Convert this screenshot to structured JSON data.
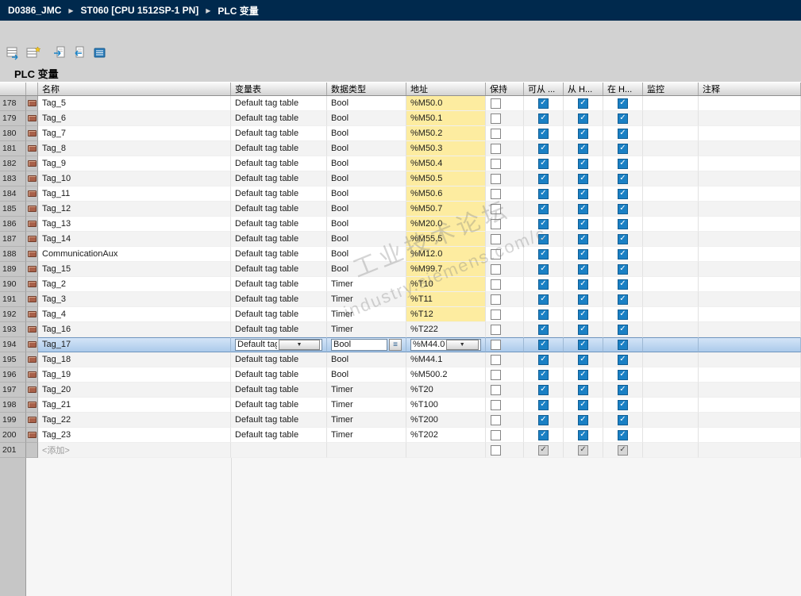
{
  "breadcrumb": {
    "items": [
      "D0386_JMC",
      "ST060 [CPU 1512SP-1 PN]",
      "PLC 变量"
    ]
  },
  "page_title": "PLC 变量",
  "toolbar": {
    "icons": [
      "insert-row-icon",
      "add-row-icon",
      "export-icon",
      "import-icon",
      "cross-reference-icon"
    ]
  },
  "watermark": {
    "line1": "工业技术论坛",
    "line2": "industry.siemens.com/c"
  },
  "colors": {
    "breadcrumb_bg": "#00294d",
    "selected_row": "#a9c9ea",
    "address_highlight": "#fdeca0",
    "checkbox_checked": "#1a80c4"
  },
  "table": {
    "headers": {
      "name": "名称",
      "tag_table": "变量表",
      "data_type": "数据类型",
      "address": "地址",
      "retain": "保持",
      "accessible": "可从 ...",
      "writable_hmi": "从 H...",
      "visible_hmi": "在 H...",
      "monitor": "监控",
      "comment": "注释"
    },
    "rows": [
      {
        "num": "178",
        "name": "Tag_5",
        "table": "Default tag table",
        "type": "Bool",
        "addr": "%M50.0",
        "yellow": true,
        "selected": false,
        "add": false
      },
      {
        "num": "179",
        "name": "Tag_6",
        "table": "Default tag table",
        "type": "Bool",
        "addr": "%M50.1",
        "yellow": true,
        "selected": false,
        "add": false
      },
      {
        "num": "180",
        "name": "Tag_7",
        "table": "Default tag table",
        "type": "Bool",
        "addr": "%M50.2",
        "yellow": true,
        "selected": false,
        "add": false
      },
      {
        "num": "181",
        "name": "Tag_8",
        "table": "Default tag table",
        "type": "Bool",
        "addr": "%M50.3",
        "yellow": true,
        "selected": false,
        "add": false
      },
      {
        "num": "182",
        "name": "Tag_9",
        "table": "Default tag table",
        "type": "Bool",
        "addr": "%M50.4",
        "yellow": true,
        "selected": false,
        "add": false
      },
      {
        "num": "183",
        "name": "Tag_10",
        "table": "Default tag table",
        "type": "Bool",
        "addr": "%M50.5",
        "yellow": true,
        "selected": false,
        "add": false
      },
      {
        "num": "184",
        "name": "Tag_11",
        "table": "Default tag table",
        "type": "Bool",
        "addr": "%M50.6",
        "yellow": true,
        "selected": false,
        "add": false
      },
      {
        "num": "185",
        "name": "Tag_12",
        "table": "Default tag table",
        "type": "Bool",
        "addr": "%M50.7",
        "yellow": true,
        "selected": false,
        "add": false
      },
      {
        "num": "186",
        "name": "Tag_13",
        "table": "Default tag table",
        "type": "Bool",
        "addr": "%M20.0",
        "yellow": true,
        "selected": false,
        "add": false
      },
      {
        "num": "187",
        "name": "Tag_14",
        "table": "Default tag table",
        "type": "Bool",
        "addr": "%M55.5",
        "yellow": true,
        "selected": false,
        "add": false
      },
      {
        "num": "188",
        "name": "CommunicationAux",
        "table": "Default tag table",
        "type": "Bool",
        "addr": "%M12.0",
        "yellow": true,
        "selected": false,
        "add": false
      },
      {
        "num": "189",
        "name": "Tag_15",
        "table": "Default tag table",
        "type": "Bool",
        "addr": "%M99.7",
        "yellow": true,
        "selected": false,
        "add": false
      },
      {
        "num": "190",
        "name": "Tag_2",
        "table": "Default tag table",
        "type": "Timer",
        "addr": "%T10",
        "yellow": true,
        "selected": false,
        "add": false
      },
      {
        "num": "191",
        "name": "Tag_3",
        "table": "Default tag table",
        "type": "Timer",
        "addr": "%T11",
        "yellow": true,
        "selected": false,
        "add": false
      },
      {
        "num": "192",
        "name": "Tag_4",
        "table": "Default tag table",
        "type": "Timer",
        "addr": "%T12",
        "yellow": true,
        "selected": false,
        "add": false
      },
      {
        "num": "193",
        "name": "Tag_16",
        "table": "Default tag table",
        "type": "Timer",
        "addr": "%T222",
        "yellow": false,
        "selected": false,
        "add": false
      },
      {
        "num": "194",
        "name": "Tag_17",
        "table": "Default tag table",
        "type": "Bool",
        "addr": "%M44.0",
        "yellow": false,
        "selected": true,
        "add": false
      },
      {
        "num": "195",
        "name": "Tag_18",
        "table": "Default tag table",
        "type": "Bool",
        "addr": "%M44.1",
        "yellow": false,
        "selected": false,
        "add": false
      },
      {
        "num": "196",
        "name": "Tag_19",
        "table": "Default tag table",
        "type": "Bool",
        "addr": "%M500.2",
        "yellow": false,
        "selected": false,
        "add": false
      },
      {
        "num": "197",
        "name": "Tag_20",
        "table": "Default tag table",
        "type": "Timer",
        "addr": "%T20",
        "yellow": false,
        "selected": false,
        "add": false
      },
      {
        "num": "198",
        "name": "Tag_21",
        "table": "Default tag table",
        "type": "Timer",
        "addr": "%T100",
        "yellow": false,
        "selected": false,
        "add": false
      },
      {
        "num": "199",
        "name": "Tag_22",
        "table": "Default tag table",
        "type": "Timer",
        "addr": "%T200",
        "yellow": false,
        "selected": false,
        "add": false
      },
      {
        "num": "200",
        "name": "Tag_23",
        "table": "Default tag table",
        "type": "Timer",
        "addr": "%T202",
        "yellow": false,
        "selected": false,
        "add": false
      },
      {
        "num": "201",
        "name": "<添加>",
        "table": "",
        "type": "",
        "addr": "",
        "yellow": false,
        "selected": false,
        "add": true
      }
    ]
  }
}
